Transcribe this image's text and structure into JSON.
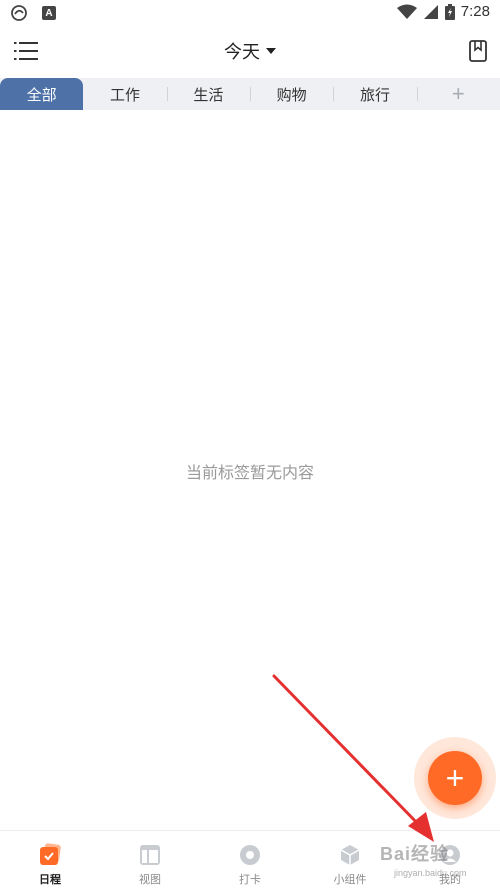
{
  "status_bar": {
    "time": "7:28",
    "badge": "A",
    "icons": [
      "app-notification-icon",
      "wifi-icon",
      "signal-icon",
      "battery-icon"
    ]
  },
  "header": {
    "title": "今天",
    "menu_icon": "menu-icon",
    "bookmark_icon": "bookmark-icon"
  },
  "tabs": [
    {
      "label": "全部",
      "active": true
    },
    {
      "label": "工作",
      "active": false
    },
    {
      "label": "生活",
      "active": false
    },
    {
      "label": "购物",
      "active": false
    },
    {
      "label": "旅行",
      "active": false
    }
  ],
  "tab_add_label": "+",
  "empty_state": "当前标签暂无内容",
  "fab_label": "+",
  "bottom_nav": [
    {
      "label": "日程",
      "icon": "schedule-icon",
      "active": true
    },
    {
      "label": "视图",
      "icon": "view-icon",
      "active": false
    },
    {
      "label": "打卡",
      "icon": "checkin-icon",
      "active": false
    },
    {
      "label": "小组件",
      "icon": "widget-icon",
      "active": false
    },
    {
      "label": "我的",
      "icon": "profile-icon",
      "active": false
    }
  ],
  "colors": {
    "accent": "#4e72a8",
    "fab": "#ff6a26",
    "arrow": "#e53030"
  },
  "watermark": {
    "text": "Bai经验",
    "sub": "jingyan.baidu.com"
  }
}
